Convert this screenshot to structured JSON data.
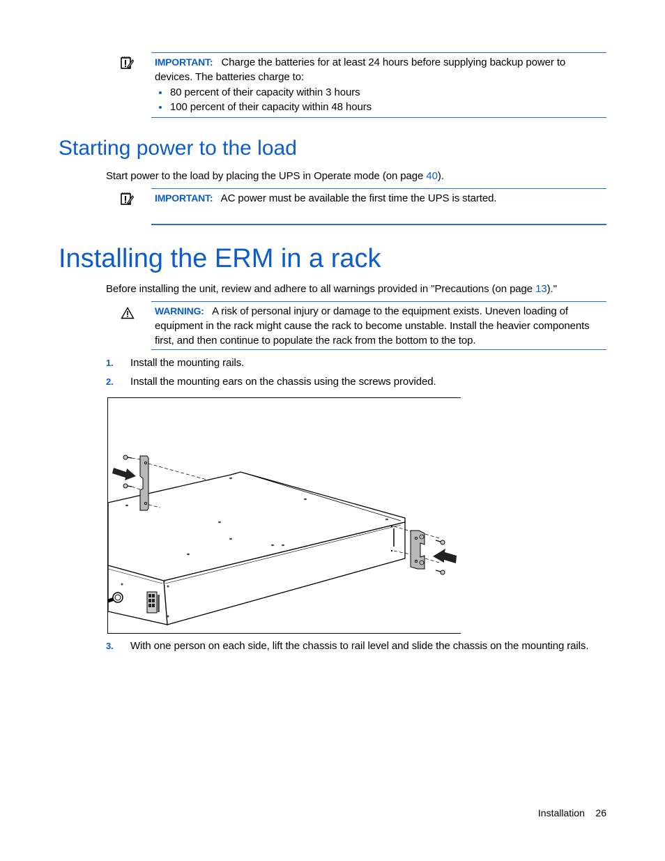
{
  "notes": [
    {
      "type": "important",
      "label": "IMPORTANT:",
      "text": "Charge the batteries for at least 24 hours before supplying backup power to",
      "text_cont": "devices. The batteries charge to:",
      "bullets": [
        "80 percent of their capacity within 3 hours",
        "100 percent of their capacity within 48 hours"
      ]
    },
    {
      "type": "important",
      "label": "IMPORTANT:",
      "text": "AC power must be available the first time the UPS is started."
    },
    {
      "type": "warning",
      "label": "WARNING:",
      "lines": [
        "A risk of personal injury or damage to the equipment exists. Uneven loading of",
        "equipment in the rack might cause the rack to become unstable. Install the heavier components",
        "first, and then continue to populate the rack from the bottom to the top."
      ]
    }
  ],
  "section1": {
    "title": "Starting power to the load",
    "para_before": "Start power to the load by placing the UPS in Operate mode (on page ",
    "link": "40",
    "para_after": ")."
  },
  "section2": {
    "title": "Installing the ERM in a rack",
    "para_before": "Before installing the unit, review and adhere to all warnings provided in \"Precautions (on page ",
    "link": "13",
    "para_after": ").\"",
    "steps": [
      {
        "num": "1.",
        "text": "Install the mounting rails."
      },
      {
        "num": "2.",
        "text": "Install the mounting ears on the chassis using the screws provided."
      },
      {
        "num": "3.",
        "text": "With one person on each side, lift the chassis to rail level and slide the chassis on the mounting rails."
      }
    ],
    "figure_alt": "Mounting ears being attached to chassis sides with screws"
  },
  "footer": {
    "section": "Installation",
    "page": "26"
  }
}
